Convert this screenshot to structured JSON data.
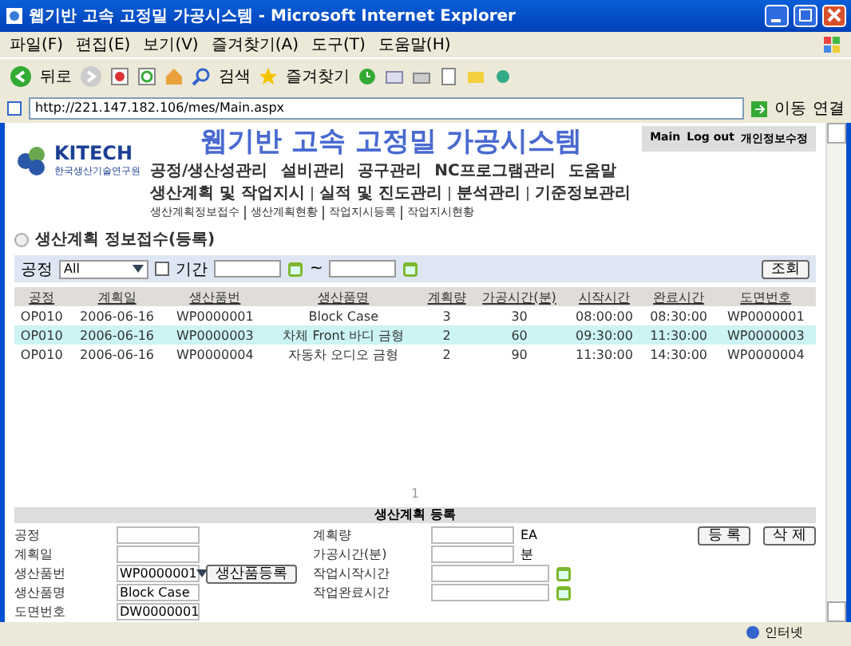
{
  "window": {
    "title": "웹기반 고속 고정밀 가공시스템 - Microsoft Internet Explorer"
  },
  "menu_bar": [
    "파일(F)",
    "편집(E)",
    "보기(V)",
    "즐겨찾기(A)",
    "도구(T)",
    "도움말(H)"
  ],
  "toolbar": {
    "back": "뒤로",
    "search": "검색",
    "favorites": "즐겨찾기"
  },
  "address_bar": {
    "url": "http://221.147.182.106/mes/Main.aspx",
    "go": "이동",
    "links": "연결"
  },
  "page": {
    "title": "웹기반 고속 고정밀 가공시스템",
    "logo": {
      "name": "KITECH",
      "subtitle": "한국생산기술연구원"
    },
    "top_links": [
      "Main",
      "Log out",
      "개인정보수정"
    ],
    "nav_primary": [
      "공정/생산성관리",
      "설비관리",
      "공구관리",
      "NC프로그램관리",
      "도움말"
    ],
    "nav_secondary": [
      "생산계획 및 작업지시",
      "실적 및 진도관리",
      "분석관리",
      "기준정보관리"
    ],
    "nav_tertiary": [
      "생산계획정보접수",
      "생산계획현황",
      "작업지시등록",
      "작업지시현황"
    ],
    "section_title": "생산계획 정보접수(등록)",
    "filter": {
      "process_label": "공정",
      "process_value": "All",
      "period_label": "기간",
      "period_checked": false,
      "range_sep": "~",
      "search_button": "조회"
    },
    "table": {
      "columns": [
        "공정",
        "계획일",
        "생산품번",
        "생산품명",
        "계획량",
        "가공시간(분)",
        "시작시간",
        "완료시간",
        "도면번호"
      ],
      "rows": [
        {
          "cells": [
            "OP010",
            "2006-06-16",
            "WP0000001",
            "Block Case",
            "3",
            "30",
            "08:00:00",
            "08:30:00",
            "WP0000001"
          ],
          "selected": false
        },
        {
          "cells": [
            "OP010",
            "2006-06-16",
            "WP0000003",
            "차체 Front 바디 금형",
            "2",
            "60",
            "09:30:00",
            "11:30:00",
            "WP0000003"
          ],
          "selected": true
        },
        {
          "cells": [
            "OP010",
            "2006-06-16",
            "WP0000004",
            "자동차 오디오 금형",
            "2",
            "90",
            "11:30:00",
            "14:30:00",
            "WP0000004"
          ],
          "selected": false
        }
      ]
    },
    "pager": "1",
    "form": {
      "title": "생산계획 등록",
      "left": [
        {
          "label": "공정",
          "kind": "input"
        },
        {
          "label": "계획일",
          "kind": "input"
        },
        {
          "label": "생산품번",
          "kind": "select",
          "value": "WP0000001",
          "button": "생산품등록"
        },
        {
          "label": "생산품명",
          "kind": "input",
          "value": "Block Case"
        },
        {
          "label": "도면번호",
          "kind": "input",
          "value": "DW0000001"
        }
      ],
      "right": [
        {
          "label": "계획량",
          "kind": "unit",
          "unit": "EA"
        },
        {
          "label": "가공시간(분)",
          "kind": "unit",
          "unit": "분"
        },
        {
          "label": "작업시작시간",
          "kind": "date"
        },
        {
          "label": "작업완료시간",
          "kind": "date"
        }
      ],
      "buttons": [
        "등 록",
        "삭 제"
      ]
    }
  },
  "status_bar": {
    "zone": "인터넷"
  }
}
